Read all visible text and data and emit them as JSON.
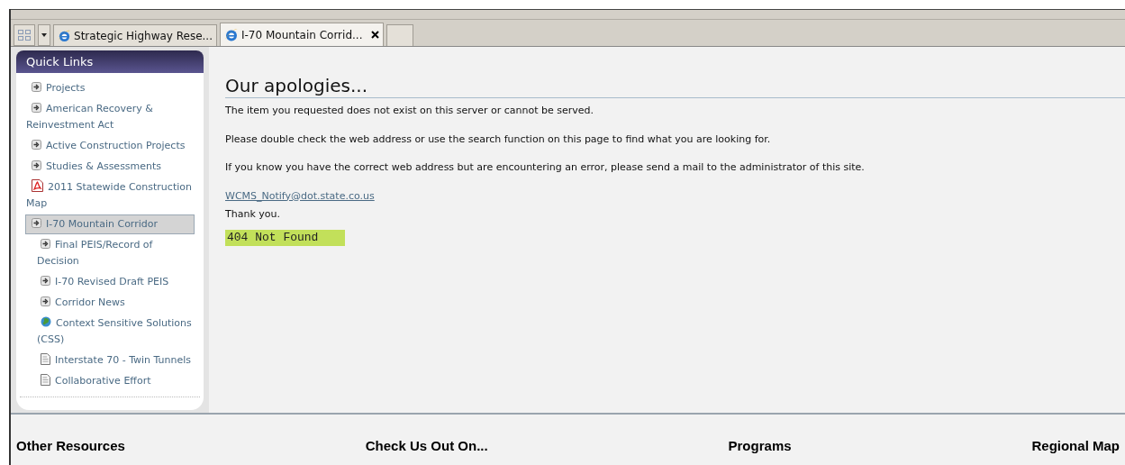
{
  "browser_tabs": [
    {
      "title": "Strategic Highway Rese...",
      "selected": false,
      "closable": false
    },
    {
      "title": "I-70 Mountain Corrid...",
      "selected": true,
      "closable": true
    }
  ],
  "sidebar": {
    "title": "Quick Links",
    "items": [
      {
        "label": "Projects",
        "kind": "arrow",
        "selected": false
      },
      {
        "label": "American Recovery & Reinvestment Act",
        "kind": "arrow",
        "selected": false
      },
      {
        "label": "Active Construction Projects",
        "kind": "arrow",
        "selected": false
      },
      {
        "label": "Studies & Assessments",
        "kind": "arrow",
        "selected": false
      },
      {
        "label": "2011 Statewide Construction Map",
        "kind": "pdf",
        "selected": false
      },
      {
        "label": "I-70 Mountain Corridor",
        "kind": "arrow",
        "selected": true,
        "children": [
          {
            "label": "Final PEIS/Record of Decision",
            "kind": "arrow",
            "selected": false
          },
          {
            "label": "I-70 Revised Draft PEIS",
            "kind": "arrow",
            "selected": false
          },
          {
            "label": "Corridor News",
            "kind": "arrow",
            "selected": false
          },
          {
            "label": "Context Sensitive Solutions (CSS)",
            "kind": "globe",
            "selected": false
          },
          {
            "label": "Interstate 70 - Twin Tunnels",
            "kind": "page",
            "selected": false
          },
          {
            "label": "Collaborative Effort",
            "kind": "page",
            "selected": false
          }
        ]
      }
    ]
  },
  "main": {
    "heading": "Our apologies...",
    "paragraphs": [
      "The item you requested does not exist on this server or cannot be served.",
      "Please double check the web address or use the search function on this page to find what you are looking for.",
      "If you know you have the correct web address but are encountering an error, please send a mail to the administrator of this site."
    ],
    "email": "WCMS_Notify@dot.state.co.us",
    "thanks": "Thank you.",
    "error_code": "404 Not Found"
  },
  "footer": {
    "headings": [
      "Other Resources",
      "Check Us Out On...",
      "Programs",
      "Regional Map"
    ]
  }
}
